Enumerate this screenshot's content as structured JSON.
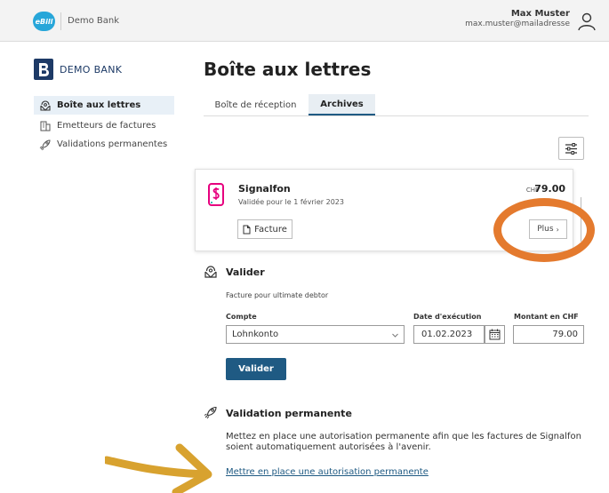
{
  "header": {
    "logo_text": "eBill",
    "bank_name": "Demo Bank",
    "user_name": "Max Muster",
    "user_email": "max.muster@mailadresse"
  },
  "sidebar": {
    "bank_logo_text": "DEMO BANK",
    "items": [
      {
        "label": "Boîte aux lettres",
        "icon": "mailbox-icon",
        "active": true
      },
      {
        "label": "Emetteurs de factures",
        "icon": "building-icon",
        "active": false
      },
      {
        "label": "Validations permanentes",
        "icon": "rocket-icon",
        "active": false
      }
    ]
  },
  "main": {
    "title": "Boîte aux lettres",
    "tabs": [
      {
        "label": "Boîte de réception",
        "active": false
      },
      {
        "label": "Archives",
        "active": true
      }
    ],
    "invoice": {
      "biller": "Signalfon",
      "status": "Validée pour le 1 février 2023",
      "currency": "CHF",
      "amount": "79.00",
      "facture_label": "Facture",
      "plus_label": "Plus"
    },
    "validate": {
      "title": "Valider",
      "note": "Facture pour ultimate debtor",
      "compte_label": "Compte",
      "compte_value": "Lohnkonto",
      "date_label": "Date d'exécution",
      "date_value": "01.02.2023",
      "amount_label": "Montant en CHF",
      "amount_value": "79.00",
      "button_label": "Valider"
    },
    "permanent": {
      "title": "Validation permanente",
      "description": "Mettez en place une autorisation permanente afin que les factures de Signalfon soient automatiquement autorisées à l'avenir.",
      "link_label": "Mettre en place une autorisation permanente"
    }
  },
  "colors": {
    "accent": "#1f5a83",
    "ebill_blue": "#27a6d9",
    "highlight_orange": "#e47a2e",
    "arrow_gold": "#d8a22f",
    "signalfon_magenta": "#e6007e"
  }
}
